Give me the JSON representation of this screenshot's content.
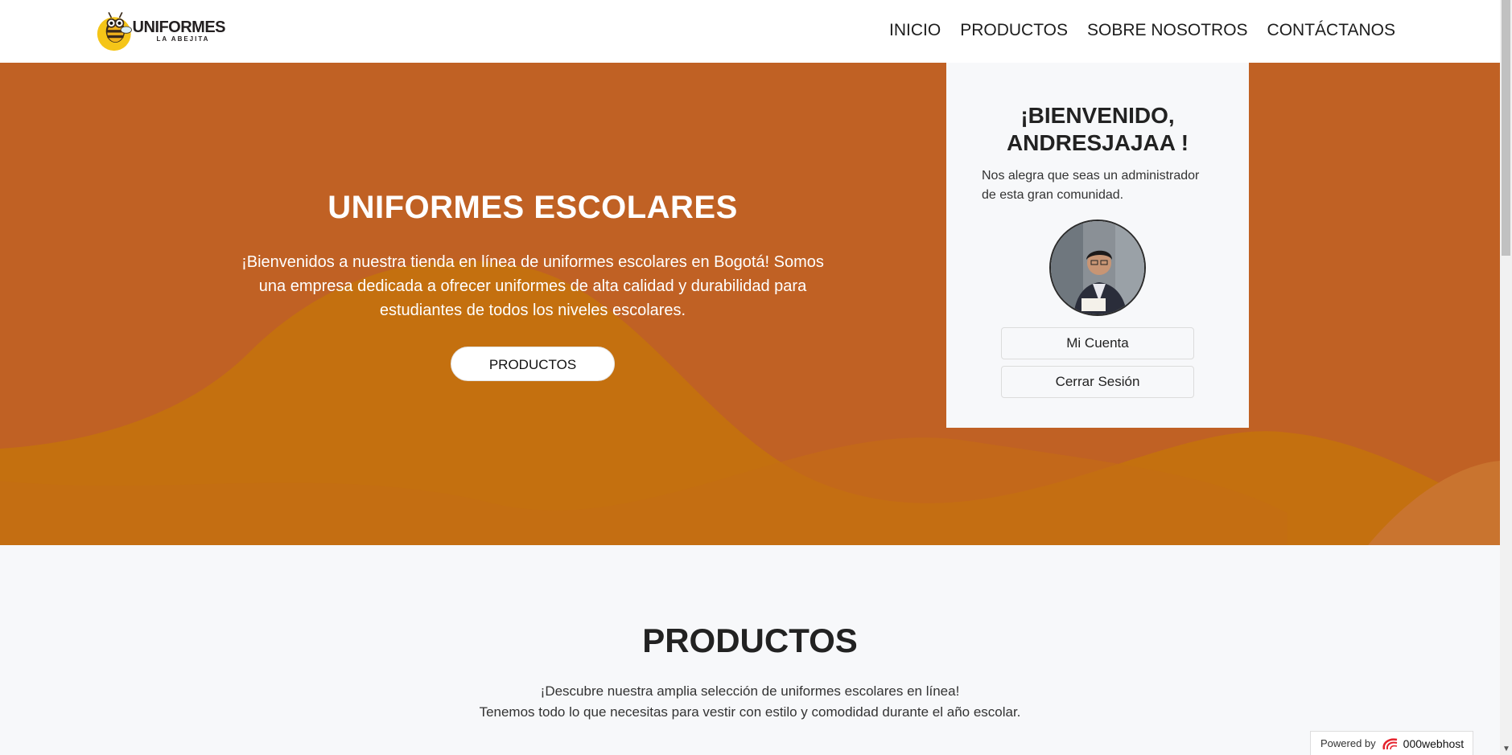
{
  "navbar": {
    "logo": {
      "main": "UNIFORMES",
      "sub": "LA ABEJITA",
      "icon": "bee-logo-icon"
    },
    "links": [
      "INICIO",
      "PRODUCTOS",
      "SOBRE NOSOTROS",
      "CONTÁCTANOS"
    ]
  },
  "hero": {
    "title": "UNIFORMES ESCOLARES",
    "text": "¡Bienvenidos a nuestra tienda en línea de uniformes escolares en Bogotá! Somos una empresa dedicada a ofrecer uniformes de alta calidad y durabilidad para estudiantes de todos los niveles escolares.",
    "button": "PRODUCTOS",
    "colors": {
      "background": "#c06124",
      "wave": "#c4700f",
      "button_bg": "#ffffff"
    }
  },
  "welcome_card": {
    "title_line1": "¡BIENVENIDO,",
    "title_line2": "ANDRESJAJAA !",
    "text": "Nos alegra que seas un administrador de esta gran comunidad.",
    "avatar": "user-avatar",
    "account_button": "Mi Cuenta",
    "logout_button": "Cerrar Sesión"
  },
  "products": {
    "title": "PRODUCTOS",
    "line1": "¡Descubre nuestra amplia selección de uniformes escolares en línea!",
    "line2": "Tenemos todo lo que necesitas para vestir con estilo y comodidad durante el año escolar."
  },
  "powered": {
    "label": "Powered by",
    "brand": "000webhost",
    "icon": "000webhost-logo-icon"
  }
}
